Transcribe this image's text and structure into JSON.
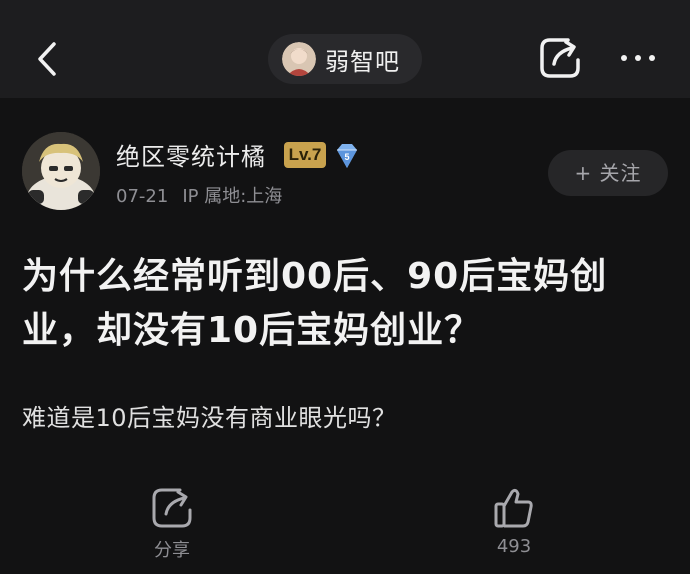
{
  "header": {
    "forum_name": "弱智吧"
  },
  "post": {
    "author": {
      "name": "绝区零统计橘",
      "level": "Lv.7",
      "diamond_number": "5"
    },
    "date": "07-21",
    "ip_location": "IP 属地:上海",
    "follow_label": "+ 关注",
    "title": "为什么经常听到00后、90后宝妈创业，却没有10后宝妈创业？",
    "body": "难道是10后宝妈没有商业眼光吗？"
  },
  "actions": {
    "share_label": "分享",
    "like_count": "493"
  },
  "colors": {
    "background": "#121213",
    "topbar": "#1d1d1f",
    "level_badge": "#c8a24e",
    "diamond": "#7fb2ee"
  },
  "icons": {
    "back": "chevron-left-icon",
    "share": "share-icon",
    "more": "more-icon",
    "diamond": "diamond-icon",
    "like": "thumbs-up-icon"
  }
}
